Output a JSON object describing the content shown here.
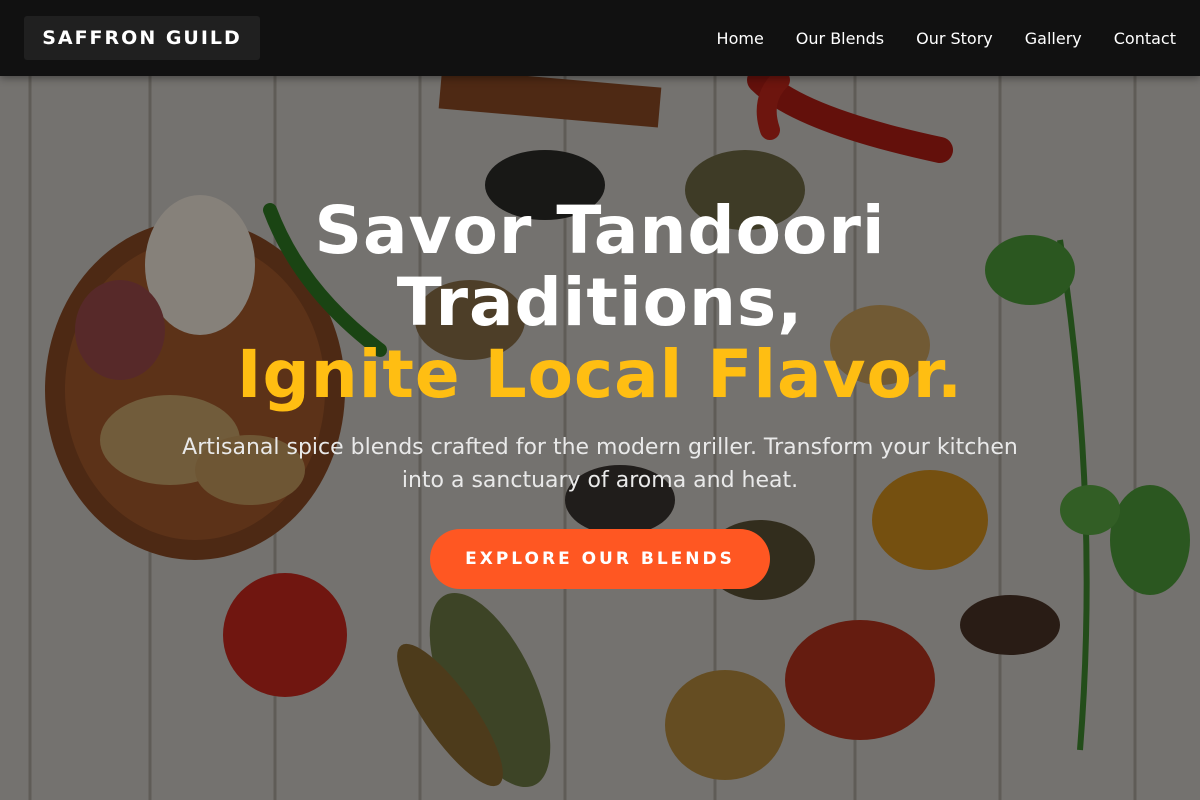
{
  "brand": {
    "name": "SAFFRON GUILD"
  },
  "nav": {
    "items": [
      {
        "label": "Home"
      },
      {
        "label": "Our Blends"
      },
      {
        "label": "Our Story"
      },
      {
        "label": "Gallery"
      },
      {
        "label": "Contact"
      }
    ]
  },
  "hero": {
    "title_line1": "Savor Tandoori",
    "title_line2": "Traditions,",
    "title_accent": "Ignite Local Flavor.",
    "subtitle": "Artisanal spice blends crafted for the modern griller. Transform your kitchen into a sanctuary of aroma and heat.",
    "cta_label": "EXPLORE OUR BLENDS"
  },
  "colors": {
    "nav_background": "#111111",
    "accent_yellow": "#ffbe12",
    "cta_orange": "#ff5722",
    "heading_white": "#ffffff"
  }
}
